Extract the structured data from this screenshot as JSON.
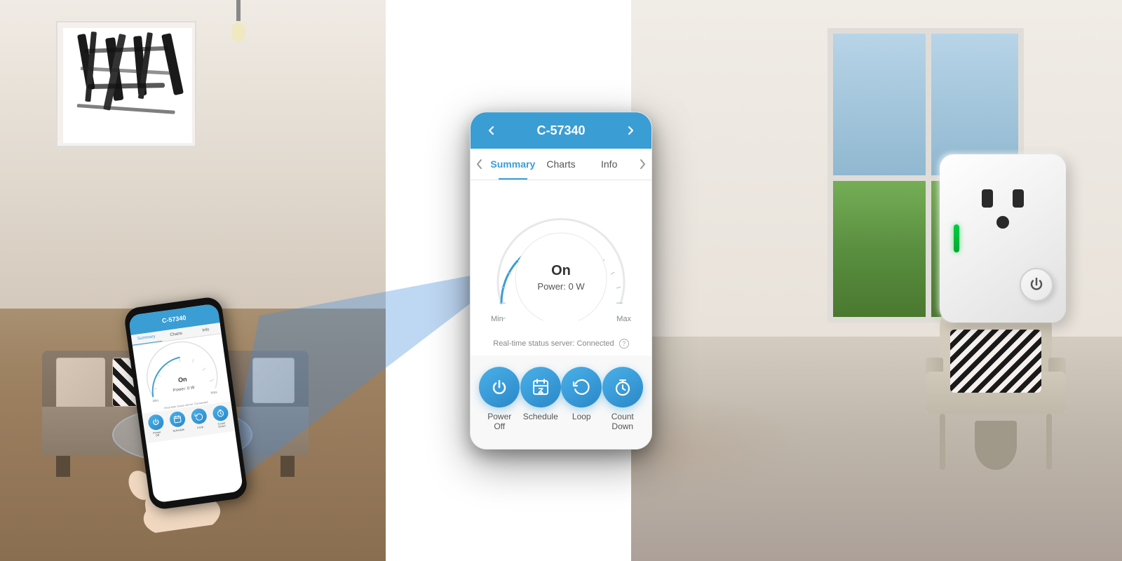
{
  "scene": {
    "bg_left_desc": "living room with sofa",
    "bg_right_desc": "bright room with chair and window"
  },
  "phone_header": {
    "back_icon": "‹",
    "title": "C-57340",
    "forward_icon": "›"
  },
  "phone_tabs": {
    "back_nav": "‹",
    "forward_nav": "›",
    "items": [
      {
        "label": "Summary",
        "active": true
      },
      {
        "label": "Charts",
        "active": false
      },
      {
        "label": "Info",
        "active": false
      }
    ]
  },
  "gauge": {
    "status": "On",
    "power_label": "Power: 0 W",
    "min_label": "Min",
    "max_label": "Max"
  },
  "status": {
    "realtime_text": "Real-time status server: Connected",
    "info_icon": "?"
  },
  "action_buttons": [
    {
      "id": "power-off",
      "label": "Power\nOff",
      "label_line1": "Power",
      "label_line2": "Off",
      "icon": "power"
    },
    {
      "id": "schedule",
      "label": "Schedule",
      "label_line1": "Schedule",
      "label_line2": "",
      "icon": "clock"
    },
    {
      "id": "loop",
      "label": "Loop",
      "label_line1": "Loop",
      "label_line2": "",
      "icon": "loop"
    },
    {
      "id": "countdown",
      "label": "Count Down",
      "label_line1": "Count",
      "label_line2": "Down",
      "icon": "countdown"
    }
  ],
  "phone_small": {
    "header_title": "C-57340",
    "tabs": [
      "Summary",
      "Charts",
      "Info"
    ],
    "gauge_status": "On",
    "gauge_power": "Power: 0 W",
    "status_text": "Real-time status server: Connected",
    "buttons": [
      "Power Off",
      "Schedule",
      "Loop",
      "Count Down"
    ]
  },
  "smart_plug": {
    "description": "White smart plug with green LED indicator and power button"
  },
  "colors": {
    "accent_blue": "#3a9dd4",
    "accent_blue_dark": "#2a88c8",
    "green_indicator": "#00cc44",
    "text_dark": "#333333",
    "text_medium": "#555555",
    "text_light": "#888888",
    "bg_white": "#ffffff",
    "bg_light": "#f8f8f8"
  }
}
